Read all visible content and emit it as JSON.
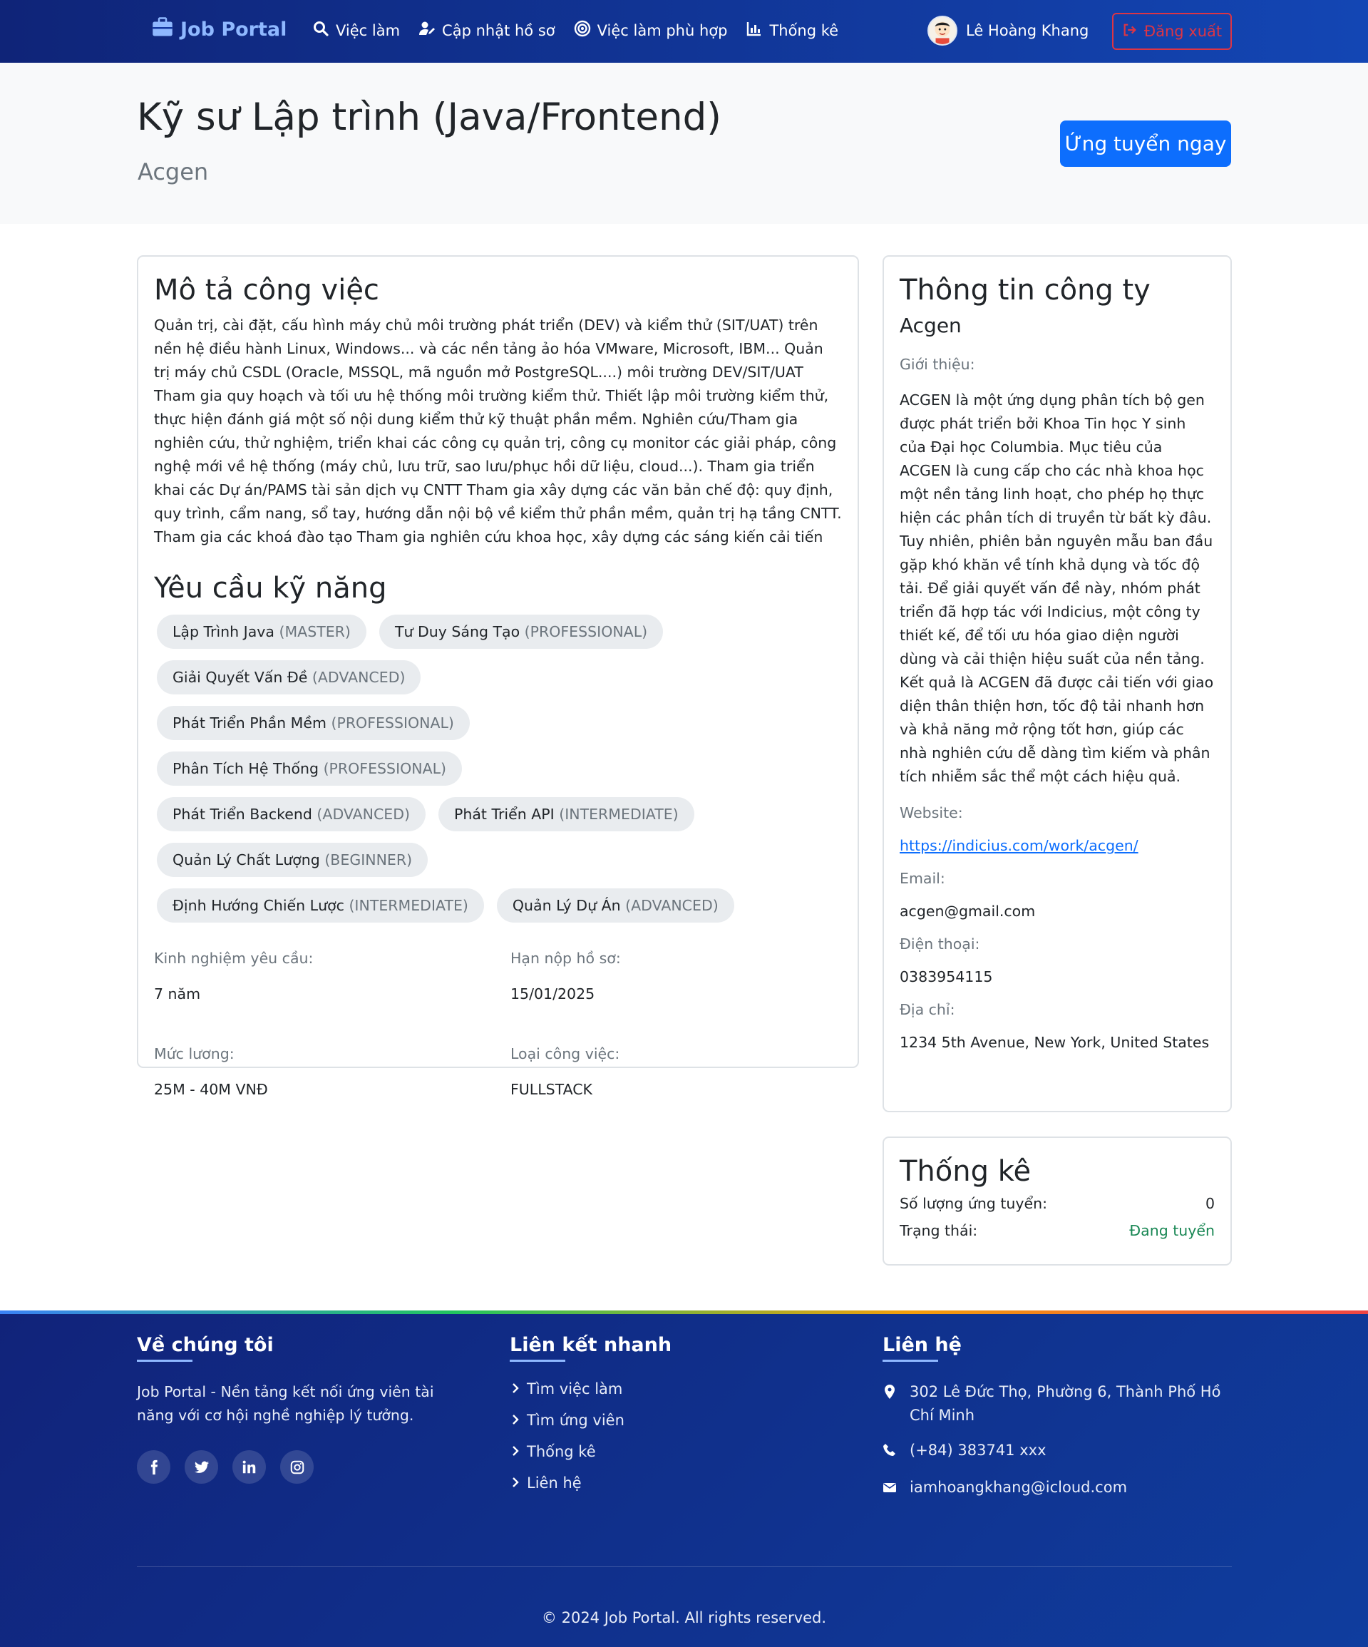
{
  "nav": {
    "brand": "Job Portal",
    "links": [
      {
        "label": "Việc làm",
        "icon": "search-icon"
      },
      {
        "label": "Cập nhật hồ sơ",
        "icon": "user-edit-icon"
      },
      {
        "label": "Việc làm phù hợp",
        "icon": "target-icon"
      },
      {
        "label": "Thống kê",
        "icon": "chart-icon"
      }
    ],
    "user_name": "Lê Hoàng Khang",
    "logout_label": "Đăng xuất"
  },
  "hero": {
    "title": "Kỹ sư Lập trình (Java/Frontend)",
    "company": "Acgen",
    "apply_label": "Ứng tuyển ngay"
  },
  "job": {
    "desc_heading": "Mô tả công việc",
    "description": "Quản trị, cài đặt, cấu hình máy chủ môi trường phát triển (DEV) và kiểm thử (SIT/UAT) trên nền hệ điều hành Linux, Windows... và các nền tảng ảo hóa VMware, Microsoft, IBM... Quản trị máy chủ CSDL (Oracle, MSSQL, mã nguồn mở PostgreSQL....) môi trường DEV/SIT/UAT Tham gia quy hoạch và tối ưu hệ thống môi trường kiểm thử. Thiết lập môi trường kiểm thử, thực hiện đánh giá một số nội dung kiểm thử kỹ thuật phần mềm. Nghiên cứu/Tham gia nghiên cứu, thử nghiệm, triển khai các công cụ quản trị, công cụ monitor các giải pháp, công nghệ mới về hệ thống (máy chủ, lưu trữ, sao lưu/phục hồi dữ liệu, cloud...). Tham gia triển khai các Dự án/PAMS tài sản dịch vụ CNTT Tham gia xây dựng các văn bản chế độ: quy định, quy trình, cẩm nang, sổ tay, hướng dẫn nội bộ về kiểm thử phần mềm, quản trị hạ tầng CNTT. Tham gia các khoá đào tạo Tham gia nghiên cứu khoa học, xây dựng các sáng kiến cải tiến",
    "skills_heading": "Yêu cầu kỹ năng",
    "skills": [
      {
        "name": "Lập Trình Java",
        "level": "(MASTER)"
      },
      {
        "name": "Tư Duy Sáng Tạo",
        "level": "(PROFESSIONAL)"
      },
      {
        "name": "Giải Quyết Vấn Đề",
        "level": "(ADVANCED)"
      },
      {
        "name": "Phát Triển Phần Mềm",
        "level": "(PROFESSIONAL)"
      },
      {
        "name": "Phân Tích Hệ Thống",
        "level": "(PROFESSIONAL)"
      },
      {
        "name": "Phát Triển Backend",
        "level": "(ADVANCED)"
      },
      {
        "name": "Phát Triển API",
        "level": "(INTERMEDIATE)"
      },
      {
        "name": "Quản Lý Chất Lượng",
        "level": "(BEGINNER)"
      },
      {
        "name": "Định Hướng Chiến Lược",
        "level": "(INTERMEDIATE)"
      },
      {
        "name": "Quản Lý Dự Án",
        "level": "(ADVANCED)"
      }
    ],
    "meta": {
      "experience_label": "Kinh nghiệm yêu cầu:",
      "experience": "7 năm",
      "deadline_label": "Hạn nộp hồ sơ:",
      "deadline": "15/01/2025",
      "salary_label": "Mức lương:",
      "salary": "25M - 40M VNĐ",
      "type_label": "Loại công việc:",
      "type": "FULLSTACK"
    }
  },
  "company": {
    "heading": "Thông tin công ty",
    "name": "Acgen",
    "intro_label": "Giới thiệu:",
    "intro": "ACGEN là một ứng dụng phân tích bộ gen được phát triển bởi Khoa Tin học Y sinh của Đại học Columbia. Mục tiêu của ACGEN là cung cấp cho các nhà khoa học một nền tảng linh hoạt, cho phép họ thực hiện các phân tích di truyền từ bất kỳ đâu. Tuy nhiên, phiên bản nguyên mẫu ban đầu gặp khó khăn về tính khả dụng và tốc độ tải. Để giải quyết vấn đề này, nhóm phát triển đã hợp tác với Indicius, một công ty thiết kế, để tối ưu hóa giao diện người dùng và cải thiện hiệu suất của nền tảng. Kết quả là ACGEN đã được cải tiến với giao diện thân thiện hơn, tốc độ tải nhanh hơn và khả năng mở rộng tốt hơn, giúp các nhà nghiên cứu dễ dàng tìm kiếm và phân tích nhiễm sắc thể một cách hiệu quả.",
    "website_label": "Website:",
    "website": "https://indicius.com/work/acgen/",
    "email_label": "Email:",
    "email": "acgen@gmail.com",
    "phone_label": "Điện thoại:",
    "phone": "0383954115",
    "address_label": "Địa chỉ:",
    "address": "1234 5th Avenue, New York, United States"
  },
  "stats": {
    "heading": "Thống kê",
    "applicants_label": "Số lượng ứng tuyển:",
    "applicants": "0",
    "status_label": "Trạng thái:",
    "status": "Đang tuyển",
    "status_color": "#198754"
  },
  "footer": {
    "about_heading": "Về chúng tôi",
    "about_text": "Job Portal - Nền tảng kết nối ứng viên tài năng với cơ hội nghề nghiệp lý tưởng.",
    "socials": [
      "facebook-icon",
      "twitter-icon",
      "linkedin-icon",
      "instagram-icon"
    ],
    "links_heading": "Liên kết nhanh",
    "links": [
      "Tìm việc làm",
      "Tìm ứng viên",
      "Thống kê",
      "Liên hệ"
    ],
    "contact_heading": "Liên hệ",
    "address": "302 Lê Đức Thọ, Phường 6, Thành Phố Hồ Chí Minh",
    "phone": "(+84) 383741 xxx",
    "email": "iamhoangkhang@icloud.com",
    "copyright": "© 2024 Job Portal. All rights reserved."
  },
  "colors": {
    "primary": "#0d6efd",
    "nav_gradient_start": "#0f2478",
    "nav_gradient_end": "#1346b4",
    "danger": "#dc3545",
    "success": "#198754"
  }
}
